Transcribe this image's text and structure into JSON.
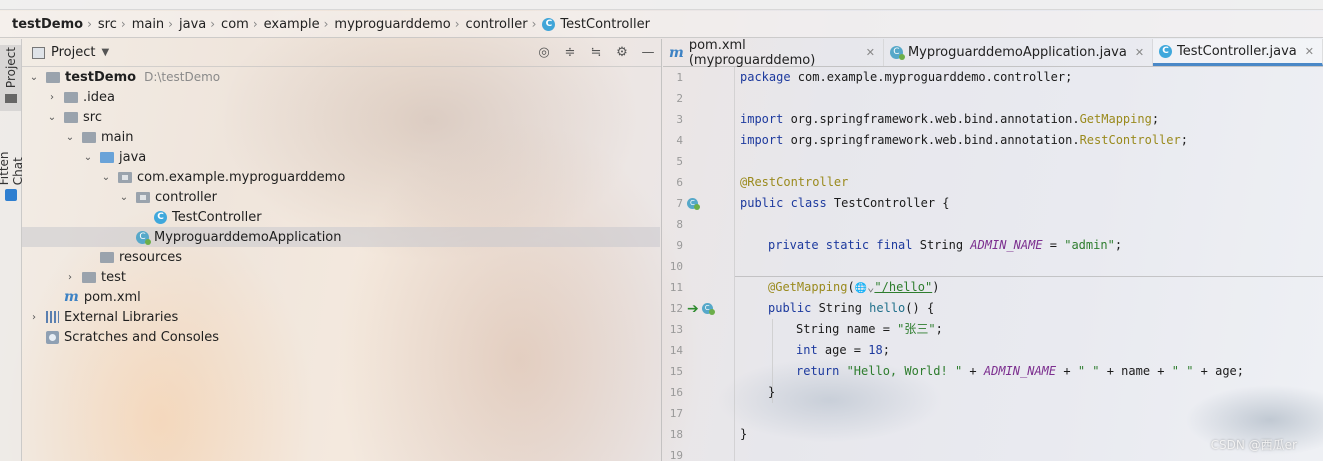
{
  "breadcrumb": [
    {
      "label": "testDemo",
      "bold": true
    },
    {
      "label": "src"
    },
    {
      "label": "main"
    },
    {
      "label": "java"
    },
    {
      "label": "com"
    },
    {
      "label": "example"
    },
    {
      "label": "myproguarddemo"
    },
    {
      "label": "controller"
    },
    {
      "label": "TestController",
      "icon": "class-icon"
    }
  ],
  "side_tabs": {
    "project": "Project",
    "fitten_chat": "Fitten Chat"
  },
  "project_panel": {
    "title": "Project"
  },
  "tree": [
    {
      "label": "testDemo",
      "extra": "D:\\testDemo"
    },
    {
      "label": ".idea"
    },
    {
      "label": "src"
    },
    {
      "label": "main"
    },
    {
      "label": "java"
    },
    {
      "label": "com.example.myproguarddemo"
    },
    {
      "label": "controller"
    },
    {
      "label": "TestController"
    },
    {
      "label": "MyproguarddemoApplication"
    },
    {
      "label": "resources"
    },
    {
      "label": "test"
    },
    {
      "label": "pom.xml"
    },
    {
      "label": "External Libraries"
    },
    {
      "label": "Scratches and Consoles"
    }
  ],
  "editor_tabs": [
    {
      "label": "pom.xml (myproguarddemo)"
    },
    {
      "label": "MyproguarddemoApplication.java"
    },
    {
      "label": "TestController.java"
    }
  ],
  "line_numbers": [
    "1",
    "2",
    "3",
    "4",
    "5",
    "6",
    "7",
    "8",
    "9",
    "10",
    "11",
    "12",
    "13",
    "14",
    "15",
    "16",
    "17",
    "18",
    "19"
  ],
  "code": {
    "l1_kw": "package",
    "l1_rest": " com.example.myproguarddemo.controller;",
    "l3_kw": "import",
    "l3_rest": " org.springframework.web.bind.annotation.",
    "l3_ann": "GetMapping",
    "l3_end": ";",
    "l4_kw": "import",
    "l4_rest": " org.springframework.web.bind.annotation.",
    "l4_ann": "RestController",
    "l4_end": ";",
    "l6_ann": "@RestController",
    "l7_kw": "public class",
    "l7_rest": " TestController {",
    "l9_kw": "private static final",
    "l9_type": " String ",
    "l9_fld": "ADMIN_NAME",
    "l9_eq": " = ",
    "l9_str": "\"admin\"",
    "l9_end": ";",
    "l11_ann": "@GetMapping",
    "l11_open": "(",
    "l11_globe": "🌐",
    "l11_chev": "⌄",
    "l11_str": "\"/hello\"",
    "l11_close": ")",
    "l12_kw": "public",
    "l12_type": " String ",
    "l12_fn": "hello",
    "l12_rest": "() {",
    "l13_type": "String",
    "l13_mid": " name = ",
    "l13_str": "\"张三\"",
    "l13_end": ";",
    "l14_kw": "int",
    "l14_mid": " age = ",
    "l14_num": "18",
    "l14_end": ";",
    "l15_kw": "return",
    "l15_str1": " \"Hello, World! \"",
    "l15_p1": " + ",
    "l15_fld": "ADMIN_NAME",
    "l15_p2": " + ",
    "l15_str2": "\" \"",
    "l15_p3": " + name + ",
    "l15_str3": "\" \"",
    "l15_p4": " + age;",
    "l16": "}",
    "l18": "}"
  },
  "watermark": "CSDN @西瓜er"
}
